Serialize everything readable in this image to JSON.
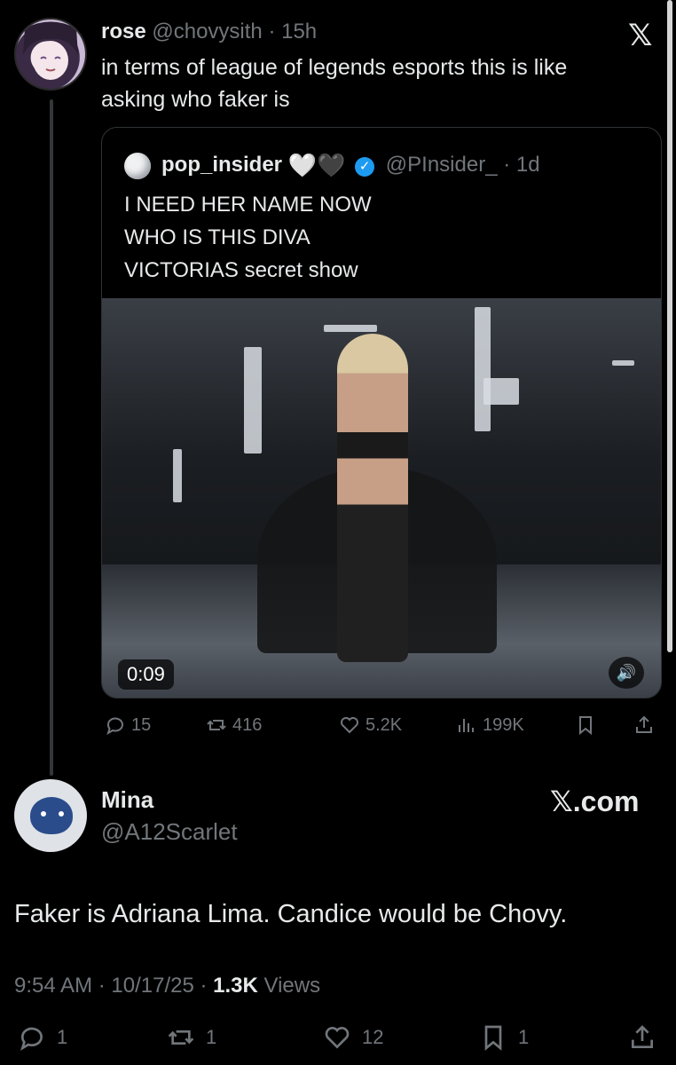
{
  "original_tweet": {
    "display_name": "rose",
    "handle": "@chovysith",
    "time": "· 15h",
    "text": "in terms of league of legends esports this is like asking who faker is"
  },
  "top_logo": "𝕏",
  "quoted_tweet": {
    "display_name": "pop_insider",
    "emoji_hearts": "🤍🖤",
    "handle": "@PInsider_",
    "time": "· 1d",
    "lines": [
      "I NEED HER NAME NOW",
      "WHO IS THIS DIVA",
      "VICTORIAS secret show"
    ],
    "video_time": "0:09"
  },
  "quoted_actions": {
    "replies": "15",
    "reposts": "416",
    "likes": "5.2K",
    "views": "199K"
  },
  "reply": {
    "display_name": "Mina",
    "handle": "@A12Scarlet",
    "text": "Faker is Adriana Lima. Candice would be Chovy.",
    "time": "9:54 AM",
    "date": "10/17/25",
    "views_count": "1.3K",
    "views_label": "Views"
  },
  "watermark": "𝕏.com",
  "reply_actions": {
    "replies": "1",
    "reposts": "1",
    "likes": "12",
    "bookmarks": "1"
  },
  "colors": {
    "background": "#000000",
    "text": "#e7e9ea",
    "muted": "#71767b",
    "verified": "#1d9bf0"
  }
}
